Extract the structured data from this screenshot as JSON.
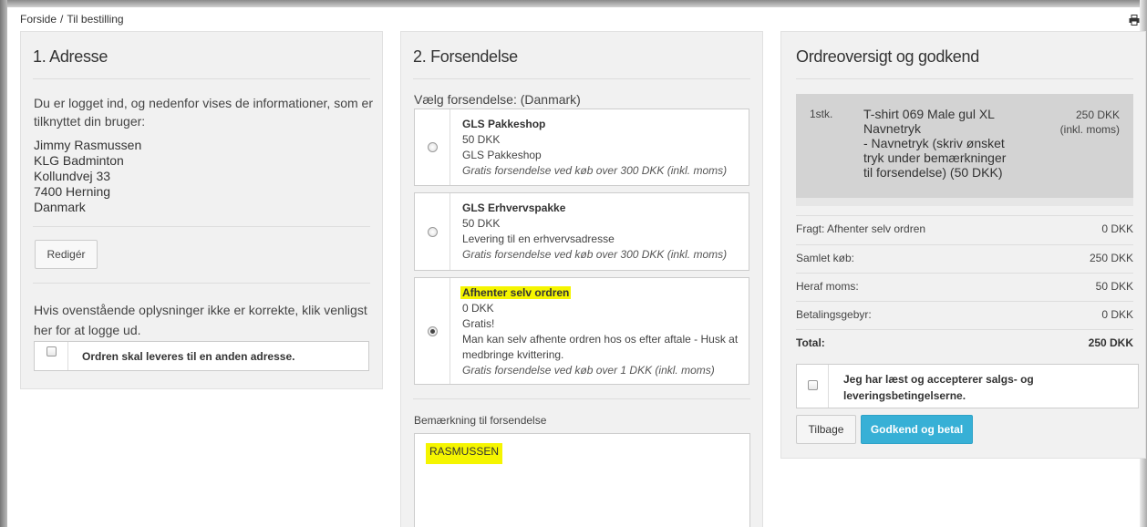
{
  "breadcrumb": {
    "home": "Forside",
    "separator": "/",
    "current": "Til bestilling"
  },
  "icons": {
    "print": "printer-icon"
  },
  "address": {
    "title": "1. Adresse",
    "intro": "Du er logget ind, og nedenfor vises de informationer, som er tilknyttet din bruger:",
    "lines": [
      "Jimmy Rasmussen",
      "KLG Badminton",
      "Kollundvej 33",
      "7400 Herning",
      "Danmark"
    ],
    "edit_label": "Redigér",
    "logout_text": "Hvis ovenstående oplysninger ikke er korrekte, klik venligst her for at logge ud.",
    "alt_address_label": "Ordren skal leveres til en anden adresse."
  },
  "shipping": {
    "title": "2. Forsendelse",
    "choose_label": "Vælg forsendelse: (Danmark)",
    "options": [
      {
        "name": "GLS Pakkeshop",
        "price": "50 DKK",
        "desc": "GLS Pakkeshop",
        "desc2": "",
        "note": "Gratis forsendelse ved køb over 300 DKK (inkl. moms)",
        "selected": false
      },
      {
        "name": "GLS Erhvervspakke",
        "price": "50 DKK",
        "desc": "Levering til en erhvervsadresse",
        "desc2": "",
        "note": "Gratis forsendelse ved køb over 300 DKK (inkl. moms)",
        "selected": false
      },
      {
        "name": "Afhenter selv ordren",
        "price": "0 DKK",
        "desc": "Gratis!",
        "desc2": "Man kan selv afhente ordren hos os efter aftale - Husk at medbringe kvittering.",
        "note": "Gratis forsendelse ved køb over 1 DKK (inkl. moms)",
        "selected": true
      }
    ],
    "remark_label": "Bemærkning til forsendelse",
    "remark_value": "RASMUSSEN",
    "highlight_color": "#f5f500"
  },
  "summary": {
    "title": "Ordreoversigt og godkend",
    "item": {
      "qty": "1stk.",
      "lines": [
        "T-shirt 069 Male gul XL",
        "Navnetryk",
        "- Navnetryk (skriv ønsket",
        "tryk under bemærkninger",
        "til forsendelse) (50 DKK)"
      ],
      "price": "250 DKK",
      "price_note": "(inkl. moms)"
    },
    "rows": [
      {
        "label": "Fragt: Afhenter selv ordren",
        "value": "0 DKK"
      },
      {
        "label": "Samlet køb:",
        "value": "250 DKK"
      },
      {
        "label": "Heraf moms:",
        "value": "50 DKK"
      },
      {
        "label": "Betalingsgebyr:",
        "value": "0 DKK"
      },
      {
        "label": "Total:",
        "value": "250 DKK"
      }
    ],
    "accept_label": "Jeg har læst og accepterer salgs- og leveringsbetingelserne.",
    "back_label": "Tilbage",
    "pay_label": "Godkend og betal",
    "accent_color": "#37b0d6"
  }
}
